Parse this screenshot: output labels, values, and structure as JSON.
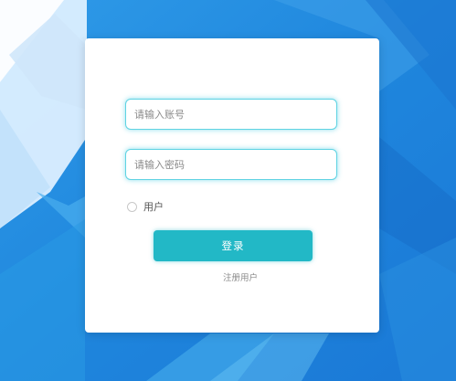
{
  "login": {
    "account_placeholder": "请输入账号",
    "password_placeholder": "请输入密码",
    "role_option_label": "用户",
    "login_button_label": "登录",
    "register_link_label": "注册用户"
  },
  "colors": {
    "background_primary": "#1e88e5",
    "background_light": "#3fa9ea",
    "field_focus_border": "#5fd3e3",
    "button": "#22b8c6"
  }
}
